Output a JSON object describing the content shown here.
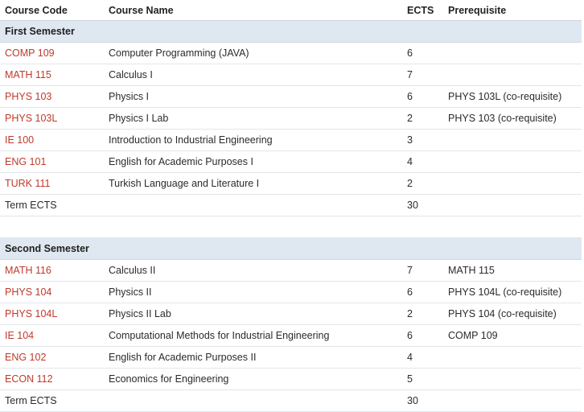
{
  "headers": {
    "code": "Course Code",
    "name": "Course Name",
    "ects": "ECTS",
    "prereq": "Prerequisite"
  },
  "semesters": [
    {
      "title": "First Semester",
      "courses": [
        {
          "code": "COMP 109",
          "name": "Computer Programming (JAVA)",
          "ects": "6",
          "prereq": ""
        },
        {
          "code": "MATH 115",
          "name": "Calculus I",
          "ects": "7",
          "prereq": ""
        },
        {
          "code": "PHYS 103",
          "name": "Physics I",
          "ects": "6",
          "prereq": "PHYS 103L (co-requisite)"
        },
        {
          "code": "PHYS 103L",
          "name": "Physics I Lab",
          "ects": "2",
          "prereq": "PHYS 103 (co-requisite)"
        },
        {
          "code": "IE 100",
          "name": "Introduction to Industrial Engineering",
          "ects": "3",
          "prereq": ""
        },
        {
          "code": "ENG 101",
          "name": "English for Academic Purposes I",
          "ects": "4",
          "prereq": ""
        },
        {
          "code": "TURK 111",
          "name": "Turkish Language and Literature I",
          "ects": "2",
          "prereq": ""
        }
      ],
      "total_label": "Term ECTS",
      "total": "30"
    },
    {
      "title": "Second Semester",
      "courses": [
        {
          "code": "MATH 116",
          "name": "Calculus II",
          "ects": "7",
          "prereq": "MATH 115"
        },
        {
          "code": "PHYS 104",
          "name": "Physics II",
          "ects": "6",
          "prereq": "PHYS 104L (co-requisite)"
        },
        {
          "code": "PHYS 104L",
          "name": "Physics II Lab",
          "ects": "2",
          "prereq": "PHYS 104 (co-requisite)"
        },
        {
          "code": "IE 104",
          "name": "Computational Methods for Industrial Engineering",
          "ects": "6",
          "prereq": "COMP 109"
        },
        {
          "code": "ENG 102",
          "name": "English for Academic Purposes II",
          "ects": "4",
          "prereq": ""
        },
        {
          "code": "ECON 112",
          "name": "Economics for Engineering",
          "ects": "5",
          "prereq": ""
        }
      ],
      "total_label": "Term ECTS",
      "total": "30"
    }
  ],
  "colors": {
    "course_link": "#c0392b",
    "semester_band": "#dfe8f1"
  }
}
